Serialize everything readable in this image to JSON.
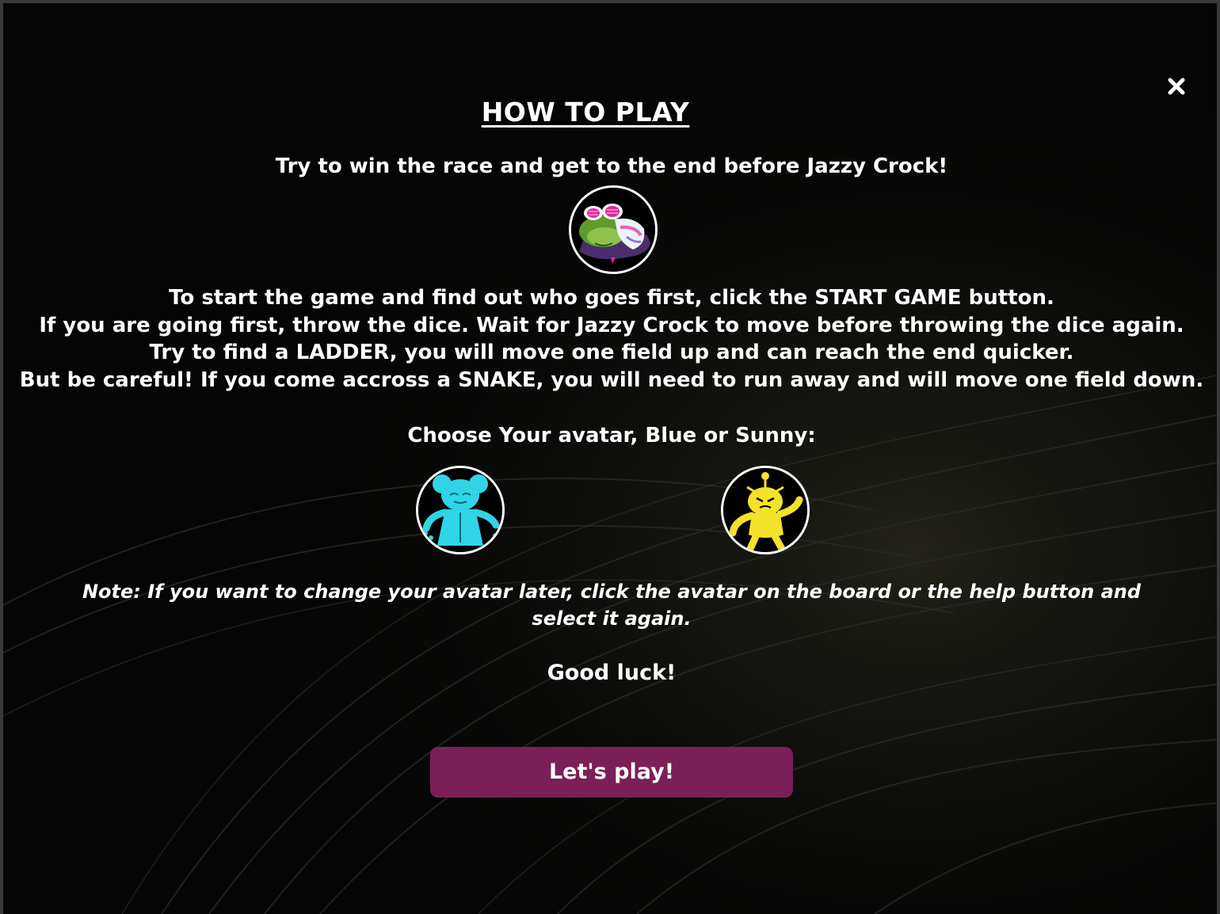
{
  "modal": {
    "title": "HOW TO PLAY",
    "intro": "Try to win the race and get to the end before Jazzy Crock!",
    "instructions": {
      "line1_pre": "To start the game and find out who goes first, click the ",
      "line1_bold": "START GAME",
      "line1_post": " button.",
      "line2": "If you are going first, throw the dice. Wait for Jazzy Crock to move before throwing the dice again.",
      "line3_pre": "Try to find a ",
      "line3_bold": "LADDER",
      "line3_post": ", you will move one field up and can reach the end quicker.",
      "line4_pre": "But be careful! If you come accross a ",
      "line4_bold": "SNAKE",
      "line4_post": ", you will need to run away and will move one field down."
    },
    "choose_prompt": "Choose Your avatar, Blue or Sunny:",
    "note": "Note: If you want to change your avatar later, click the avatar on the board or the help button and select it again.",
    "good_luck": "Good luck!",
    "play_button": "Let's play!",
    "close_icon": "close-icon"
  },
  "avatars": [
    {
      "name": "Blue",
      "color": "#2fd5e6"
    },
    {
      "name": "Sunny",
      "color": "#f3e22a"
    }
  ],
  "opponent": {
    "name": "Jazzy Crock",
    "color": "#4f8a2a"
  },
  "colors": {
    "background": "#050505",
    "button": "#7b1f58",
    "text": "#ffffff"
  }
}
